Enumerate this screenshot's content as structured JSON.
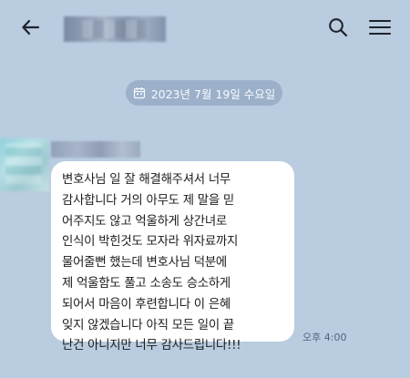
{
  "header": {
    "back_icon": "arrow-left-icon",
    "search_icon": "search-icon",
    "menu_icon": "hamburger-menu-icon"
  },
  "date_separator": {
    "icon": "calendar-icon",
    "label": "2023년 7월 19일 수요일"
  },
  "message": {
    "lines": [
      "변호사님 일 잘 해결해주셔서 너무",
      "감사합니다 거의 아무도 제 말을 믿",
      "어주지도 않고 억울하게 상간녀로",
      "인식이 박힌것도 모자라 위자료까지",
      "물어줄뻔 했는데 변호사님 덕분에",
      "제 억울함도 풀고 소송도 승소하게",
      "되어서 마음이 후련합니다 이 은혜",
      "잊지 않겠습니다 아직 모든 일이 끝",
      "난건 아니지만 너무 감사드립니다!!!"
    ],
    "time": "오후 4:00"
  },
  "colors": {
    "background": "#b9cce0",
    "bubble": "#ffffff",
    "date_pill": "#9cb0c9",
    "text": "#1b1b1b",
    "time_text": "#52627a"
  }
}
